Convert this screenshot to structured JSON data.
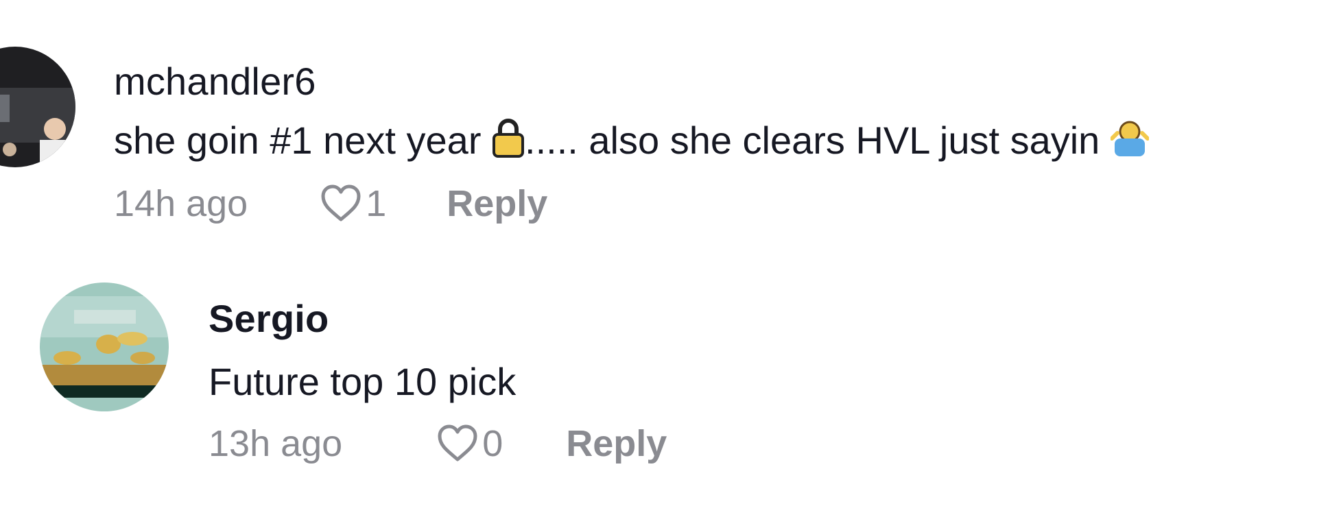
{
  "comments": [
    {
      "username": "mchandler6",
      "text_before": "she goin #1 next year",
      "emoji_1": "lock-emoji",
      "text_after": "..... also she clears HVL just sayin",
      "emoji_2": "shrug-emoji",
      "time": "14h ago",
      "likes": "1",
      "reply_label": "Reply"
    },
    {
      "username": "Sergio",
      "text": "Future top 10 pick",
      "time": "13h ago",
      "likes": "0",
      "reply_label": "Reply"
    }
  ]
}
